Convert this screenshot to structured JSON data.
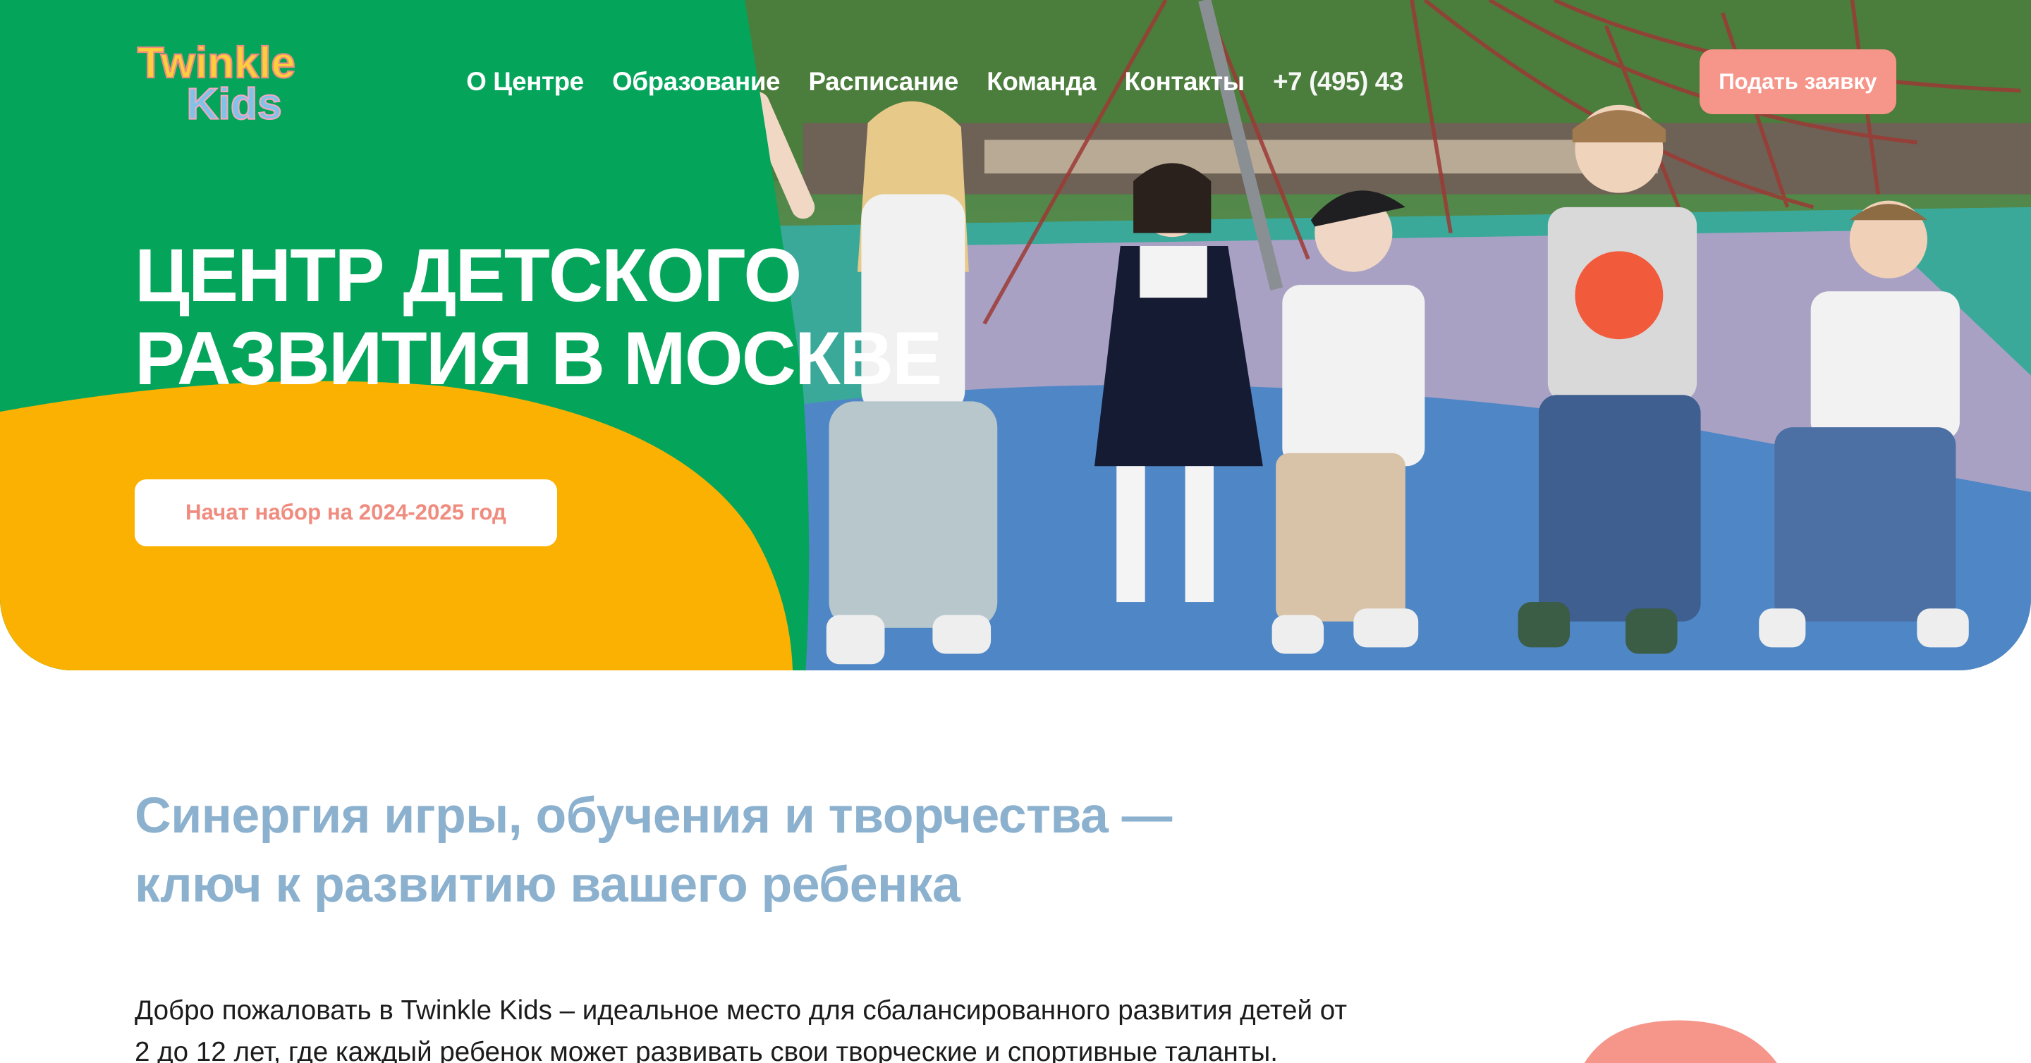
{
  "header": {
    "logo_line1": "Twinkle",
    "logo_line2": "Kids",
    "nav": [
      {
        "label": "О Центре"
      },
      {
        "label": "Образование"
      },
      {
        "label": "Расписание"
      },
      {
        "label": "Команда"
      },
      {
        "label": "Контакты"
      }
    ],
    "phone": "+7 (495) 43",
    "apply_label": "Подать заявку"
  },
  "hero": {
    "title_line1": "ЦЕНТР ДЕТСКОГО",
    "title_line2": "РАЗВИТИЯ В МОСКВЕ",
    "cta_label": "Начат набор на 2024-2025 год",
    "photo_icon": "children-playground-photo"
  },
  "intro": {
    "tagline_line1": "Синергия игры, обучения и творчества —",
    "tagline_line2": "ключ к развитию вашего ребенка",
    "text_line1": "Добро пожаловать в Twinkle Kids – идеальное место для сбалансированного развития детей от",
    "text_line2": "2 до 12 лет, где каждый ребенок может развивать свои творческие и спортивные таланты."
  },
  "colors": {
    "green": "#04a55a",
    "yellow": "#fbb101",
    "coral": "#f6958a",
    "tagline": "#8cb1ce"
  }
}
